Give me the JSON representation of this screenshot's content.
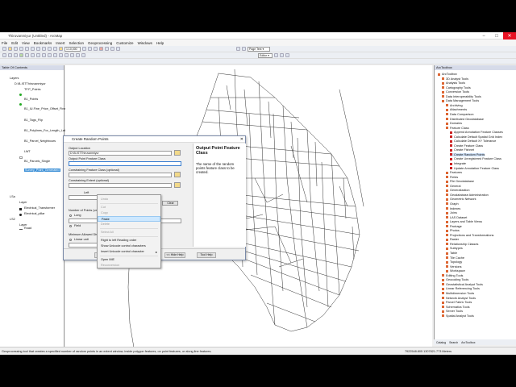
{
  "window": {
    "title": "Thiruvanmiyur (Untitled) - ArcMap",
    "buttons": [
      "−",
      "□",
      "✕"
    ]
  },
  "menubar": [
    "File",
    "Edit",
    "View",
    "Bookmarks",
    "Insert",
    "Selection",
    "Geoprocessing",
    "Customize",
    "Windows",
    "Help"
  ],
  "toolbar": {
    "scale": "1:10,000",
    "page_text": "Page Text ▾",
    "editor": "Editor ▾"
  },
  "toc": {
    "title": "Table Of Contents",
    "items": [
      {
        "label": "Layers",
        "indent": 1
      },
      {
        "label": "D:\\B-ISTThiruvanmiyur",
        "indent": 2
      },
      {
        "label": "TF.P_Points",
        "indent": 3
      },
      {
        "label": "B1_Points",
        "indent": 3
      },
      {
        "label": "B1_IU.Fine_Price_Offset_Final",
        "indent": 3
      },
      {
        "label": "B1_Tags_Flip",
        "indent": 3
      },
      {
        "label": "B1_Polylines_For_Length_Labelling",
        "indent": 3
      },
      {
        "label": "B1_Parcel_Neighbours",
        "indent": 3
      },
      {
        "label": "LWT",
        "indent": 3
      },
      {
        "label": "B1_Parcels_Single",
        "indent": 3
      },
      {
        "label": "Survey_Point_Generated",
        "indent": 3
      },
      {
        "label": "LSa",
        "indent": 1
      },
      {
        "label": "Layer",
        "indent": 2
      },
      {
        "label": "Electrical_Transformer",
        "indent": 3
      },
      {
        "label": "Electrical_pillar",
        "indent": 3
      },
      {
        "label": "LS2",
        "indent": 1
      },
      {
        "label": "Layer",
        "indent": 2
      },
      {
        "label": "Road",
        "indent": 3
      }
    ]
  },
  "dialog": {
    "title": "Create Random Points",
    "output_location_label": "Output Location",
    "output_location_value": "D:\\B-ISTThiruvanmiyur",
    "output_fc_label": "Output Point Feature Class",
    "output_fc_value": "",
    "constraining_fc_label": "Constraining Feature Class (optional)",
    "constraining_extent_label": "Constraining Extent (optional)",
    "extent_left_label": "Left",
    "clear_label": "Clear",
    "num_points_label": "Number of Points (value or field)",
    "long_label": "Long",
    "field_label": "Field",
    "min_distance_label": "Minimum Allowed Distance (value or field) (optional)",
    "linear_unit_label": "Linear unit",
    "unknown_label": "Unknown",
    "help_title": "Output Point Feature Class",
    "help_body": "The name of the random points feature class to be created.",
    "buttons": {
      "ok": "OK",
      "cancel": "Cancel",
      "environments": "Environments...",
      "hide_help": "<< Hide Help",
      "tool_help": "Tool Help"
    }
  },
  "context_menu": {
    "items": [
      {
        "label": "Undo",
        "disabled": true
      },
      {
        "label": "Cut",
        "disabled": true
      },
      {
        "label": "Copy",
        "disabled": true
      },
      {
        "label": "Paste",
        "disabled": false,
        "highlighted": true
      },
      {
        "label": "Delete",
        "disabled": true
      },
      {
        "label": "Select All",
        "disabled": true
      },
      {
        "label": "Right to left Reading order",
        "disabled": false
      },
      {
        "label": "Show Unicode control characters",
        "disabled": false
      },
      {
        "label": "Insert Unicode control character",
        "disabled": false,
        "submenu": true
      },
      {
        "label": "Open IME",
        "disabled": false
      },
      {
        "label": "Reconversion",
        "disabled": true
      }
    ]
  },
  "arctoolbox": {
    "title": "ArcToolbox",
    "items": [
      {
        "label": "ArcToolbox",
        "indent": 0,
        "kind": "root"
      },
      {
        "label": "3D Analyst Tools",
        "indent": 1,
        "kind": "box"
      },
      {
        "label": "Analysis Tools",
        "indent": 1,
        "kind": "box"
      },
      {
        "label": "Cartography Tools",
        "indent": 1,
        "kind": "box"
      },
      {
        "label": "Conversion Tools",
        "indent": 1,
        "kind": "box"
      },
      {
        "label": "Data Interoperability Tools",
        "indent": 1,
        "kind": "box"
      },
      {
        "label": "Data Management Tools",
        "indent": 1,
        "kind": "box"
      },
      {
        "label": "Archiving",
        "indent": 2,
        "kind": "box"
      },
      {
        "label": "Attachments",
        "indent": 2,
        "kind": "box"
      },
      {
        "label": "Data Comparison",
        "indent": 2,
        "kind": "box"
      },
      {
        "label": "Distributed Geodatabase",
        "indent": 2,
        "kind": "box"
      },
      {
        "label": "Domains",
        "indent": 2,
        "kind": "box"
      },
      {
        "label": "Feature Class",
        "indent": 2,
        "kind": "box"
      },
      {
        "label": "Append Annotation Feature Classes",
        "indent": 3,
        "kind": "tool"
      },
      {
        "label": "Calculate Default Spatial Grid Index",
        "indent": 3,
        "kind": "tool"
      },
      {
        "label": "Calculate Default XY Tolerance",
        "indent": 3,
        "kind": "tool"
      },
      {
        "label": "Create Feature Class",
        "indent": 3,
        "kind": "tool"
      },
      {
        "label": "Create Fishnet",
        "indent": 3,
        "kind": "tool"
      },
      {
        "label": "Create Random Points",
        "indent": 3,
        "kind": "tool",
        "selected": true
      },
      {
        "label": "Create Unregistered Feature Class",
        "indent": 3,
        "kind": "tool"
      },
      {
        "label": "Integrate",
        "indent": 3,
        "kind": "tool"
      },
      {
        "label": "Update Annotation Feature Class",
        "indent": 3,
        "kind": "tool"
      },
      {
        "label": "Features",
        "indent": 2,
        "kind": "box"
      },
      {
        "label": "Fields",
        "indent": 2,
        "kind": "box"
      },
      {
        "label": "File Geodatabase",
        "indent": 2,
        "kind": "box"
      },
      {
        "label": "General",
        "indent": 2,
        "kind": "box"
      },
      {
        "label": "Generalization",
        "indent": 2,
        "kind": "box"
      },
      {
        "label": "Geodatabase Administration",
        "indent": 2,
        "kind": "box"
      },
      {
        "label": "Geometric Network",
        "indent": 2,
        "kind": "box"
      },
      {
        "label": "Graph",
        "indent": 2,
        "kind": "box"
      },
      {
        "label": "Indexes",
        "indent": 2,
        "kind": "box"
      },
      {
        "label": "Joins",
        "indent": 2,
        "kind": "box"
      },
      {
        "label": "LAS Dataset",
        "indent": 2,
        "kind": "box"
      },
      {
        "label": "Layers and Table Views",
        "indent": 2,
        "kind": "box"
      },
      {
        "label": "Package",
        "indent": 2,
        "kind": "box"
      },
      {
        "label": "Photos",
        "indent": 2,
        "kind": "box"
      },
      {
        "label": "Projections and Transformations",
        "indent": 2,
        "kind": "box"
      },
      {
        "label": "Raster",
        "indent": 2,
        "kind": "box"
      },
      {
        "label": "Relationship Classes",
        "indent": 2,
        "kind": "box"
      },
      {
        "label": "Subtypes",
        "indent": 2,
        "kind": "box"
      },
      {
        "label": "Table",
        "indent": 2,
        "kind": "box"
      },
      {
        "label": "Tile Cache",
        "indent": 2,
        "kind": "box"
      },
      {
        "label": "Topology",
        "indent": 2,
        "kind": "box"
      },
      {
        "label": "Versions",
        "indent": 2,
        "kind": "box"
      },
      {
        "label": "Workspace",
        "indent": 2,
        "kind": "box"
      },
      {
        "label": "Editing Tools",
        "indent": 1,
        "kind": "box"
      },
      {
        "label": "Geocoding Tools",
        "indent": 1,
        "kind": "box"
      },
      {
        "label": "Geostatistical Analyst Tools",
        "indent": 1,
        "kind": "box"
      },
      {
        "label": "Linear Referencing Tools",
        "indent": 1,
        "kind": "box"
      },
      {
        "label": "Multidimension Tools",
        "indent": 1,
        "kind": "box"
      },
      {
        "label": "Network Analyst Tools",
        "indent": 1,
        "kind": "box"
      },
      {
        "label": "Parcel Fabric Tools",
        "indent": 1,
        "kind": "box"
      },
      {
        "label": "Schematics Tools",
        "indent": 1,
        "kind": "box"
      },
      {
        "label": "Server Tools",
        "indent": 1,
        "kind": "box"
      },
      {
        "label": "Spatial Analyst Tools",
        "indent": 1,
        "kind": "box"
      }
    ],
    "tabs": [
      "Catalog",
      "Search",
      "ArcToolbox"
    ]
  },
  "status": {
    "text": "Geoprocessing tool that creates a specified number of random points in an extent window, inside polygon features, on point features, or along line features.",
    "coords": "7922548.805  1307821.773 Meters"
  }
}
